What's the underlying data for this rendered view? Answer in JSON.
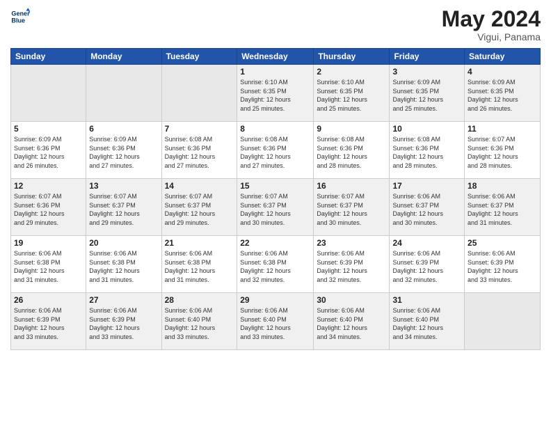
{
  "header": {
    "logo_line1": "General",
    "logo_line2": "Blue",
    "month_year": "May 2024",
    "location": "Vigui, Panama"
  },
  "days_of_week": [
    "Sunday",
    "Monday",
    "Tuesday",
    "Wednesday",
    "Thursday",
    "Friday",
    "Saturday"
  ],
  "weeks": [
    [
      {
        "day": "",
        "info": ""
      },
      {
        "day": "",
        "info": ""
      },
      {
        "day": "",
        "info": ""
      },
      {
        "day": "1",
        "info": "Sunrise: 6:10 AM\nSunset: 6:35 PM\nDaylight: 12 hours\nand 25 minutes."
      },
      {
        "day": "2",
        "info": "Sunrise: 6:10 AM\nSunset: 6:35 PM\nDaylight: 12 hours\nand 25 minutes."
      },
      {
        "day": "3",
        "info": "Sunrise: 6:09 AM\nSunset: 6:35 PM\nDaylight: 12 hours\nand 25 minutes."
      },
      {
        "day": "4",
        "info": "Sunrise: 6:09 AM\nSunset: 6:35 PM\nDaylight: 12 hours\nand 26 minutes."
      }
    ],
    [
      {
        "day": "5",
        "info": "Sunrise: 6:09 AM\nSunset: 6:36 PM\nDaylight: 12 hours\nand 26 minutes."
      },
      {
        "day": "6",
        "info": "Sunrise: 6:09 AM\nSunset: 6:36 PM\nDaylight: 12 hours\nand 27 minutes."
      },
      {
        "day": "7",
        "info": "Sunrise: 6:08 AM\nSunset: 6:36 PM\nDaylight: 12 hours\nand 27 minutes."
      },
      {
        "day": "8",
        "info": "Sunrise: 6:08 AM\nSunset: 6:36 PM\nDaylight: 12 hours\nand 27 minutes."
      },
      {
        "day": "9",
        "info": "Sunrise: 6:08 AM\nSunset: 6:36 PM\nDaylight: 12 hours\nand 28 minutes."
      },
      {
        "day": "10",
        "info": "Sunrise: 6:08 AM\nSunset: 6:36 PM\nDaylight: 12 hours\nand 28 minutes."
      },
      {
        "day": "11",
        "info": "Sunrise: 6:07 AM\nSunset: 6:36 PM\nDaylight: 12 hours\nand 28 minutes."
      }
    ],
    [
      {
        "day": "12",
        "info": "Sunrise: 6:07 AM\nSunset: 6:36 PM\nDaylight: 12 hours\nand 29 minutes."
      },
      {
        "day": "13",
        "info": "Sunrise: 6:07 AM\nSunset: 6:37 PM\nDaylight: 12 hours\nand 29 minutes."
      },
      {
        "day": "14",
        "info": "Sunrise: 6:07 AM\nSunset: 6:37 PM\nDaylight: 12 hours\nand 29 minutes."
      },
      {
        "day": "15",
        "info": "Sunrise: 6:07 AM\nSunset: 6:37 PM\nDaylight: 12 hours\nand 30 minutes."
      },
      {
        "day": "16",
        "info": "Sunrise: 6:07 AM\nSunset: 6:37 PM\nDaylight: 12 hours\nand 30 minutes."
      },
      {
        "day": "17",
        "info": "Sunrise: 6:06 AM\nSunset: 6:37 PM\nDaylight: 12 hours\nand 30 minutes."
      },
      {
        "day": "18",
        "info": "Sunrise: 6:06 AM\nSunset: 6:37 PM\nDaylight: 12 hours\nand 31 minutes."
      }
    ],
    [
      {
        "day": "19",
        "info": "Sunrise: 6:06 AM\nSunset: 6:38 PM\nDaylight: 12 hours\nand 31 minutes."
      },
      {
        "day": "20",
        "info": "Sunrise: 6:06 AM\nSunset: 6:38 PM\nDaylight: 12 hours\nand 31 minutes."
      },
      {
        "day": "21",
        "info": "Sunrise: 6:06 AM\nSunset: 6:38 PM\nDaylight: 12 hours\nand 31 minutes."
      },
      {
        "day": "22",
        "info": "Sunrise: 6:06 AM\nSunset: 6:38 PM\nDaylight: 12 hours\nand 32 minutes."
      },
      {
        "day": "23",
        "info": "Sunrise: 6:06 AM\nSunset: 6:39 PM\nDaylight: 12 hours\nand 32 minutes."
      },
      {
        "day": "24",
        "info": "Sunrise: 6:06 AM\nSunset: 6:39 PM\nDaylight: 12 hours\nand 32 minutes."
      },
      {
        "day": "25",
        "info": "Sunrise: 6:06 AM\nSunset: 6:39 PM\nDaylight: 12 hours\nand 33 minutes."
      }
    ],
    [
      {
        "day": "26",
        "info": "Sunrise: 6:06 AM\nSunset: 6:39 PM\nDaylight: 12 hours\nand 33 minutes."
      },
      {
        "day": "27",
        "info": "Sunrise: 6:06 AM\nSunset: 6:39 PM\nDaylight: 12 hours\nand 33 minutes."
      },
      {
        "day": "28",
        "info": "Sunrise: 6:06 AM\nSunset: 6:40 PM\nDaylight: 12 hours\nand 33 minutes."
      },
      {
        "day": "29",
        "info": "Sunrise: 6:06 AM\nSunset: 6:40 PM\nDaylight: 12 hours\nand 33 minutes."
      },
      {
        "day": "30",
        "info": "Sunrise: 6:06 AM\nSunset: 6:40 PM\nDaylight: 12 hours\nand 34 minutes."
      },
      {
        "day": "31",
        "info": "Sunrise: 6:06 AM\nSunset: 6:40 PM\nDaylight: 12 hours\nand 34 minutes."
      },
      {
        "day": "",
        "info": ""
      }
    ]
  ]
}
